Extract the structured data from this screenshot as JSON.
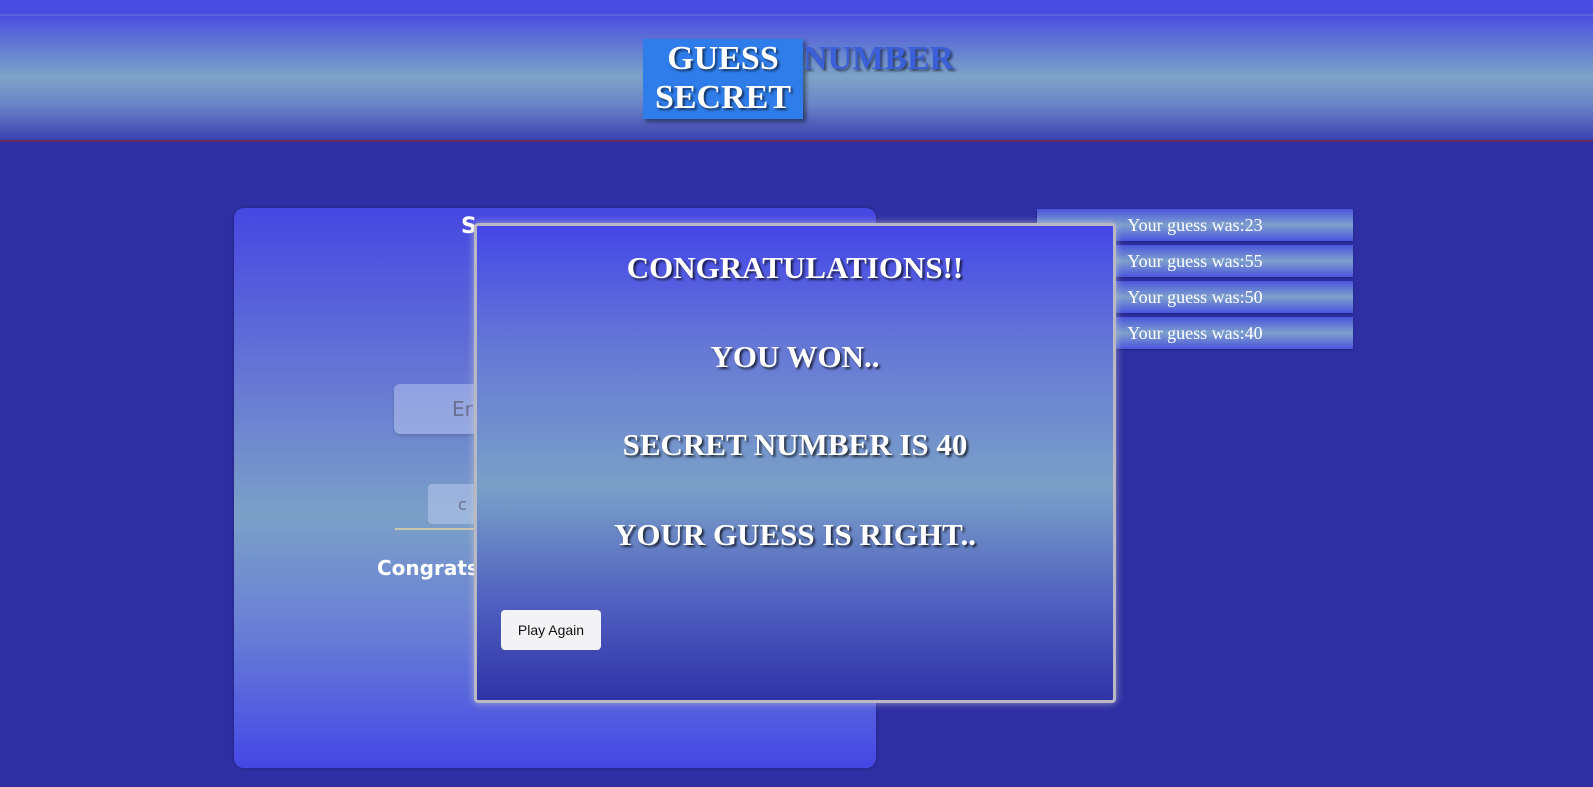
{
  "header": {
    "title_line1": "GUESS",
    "title_line2": "SECRET",
    "title_number": "NUMBER"
  },
  "game_panel": {
    "heading_visible": "S",
    "input_placeholder_visible": "Er",
    "check_button_visible": "c",
    "result_visible": "Congrats"
  },
  "history": [
    "Your guess was:23",
    "Your guess was:55",
    "Your guess was:50",
    "Your guess was:40"
  ],
  "modal": {
    "line1": "CONGRATULATIONS!!",
    "line2": "YOU WON..",
    "line3": "SECRET NUMBER IS 40",
    "line4": "YOUR GUESS IS RIGHT..",
    "play_again_label": "Play Again"
  },
  "colors": {
    "background": "#2e2fa3",
    "title_box": "#2f7dea",
    "title_number_text": "#3b5fd8",
    "modal_border": "#b9b9c4"
  }
}
